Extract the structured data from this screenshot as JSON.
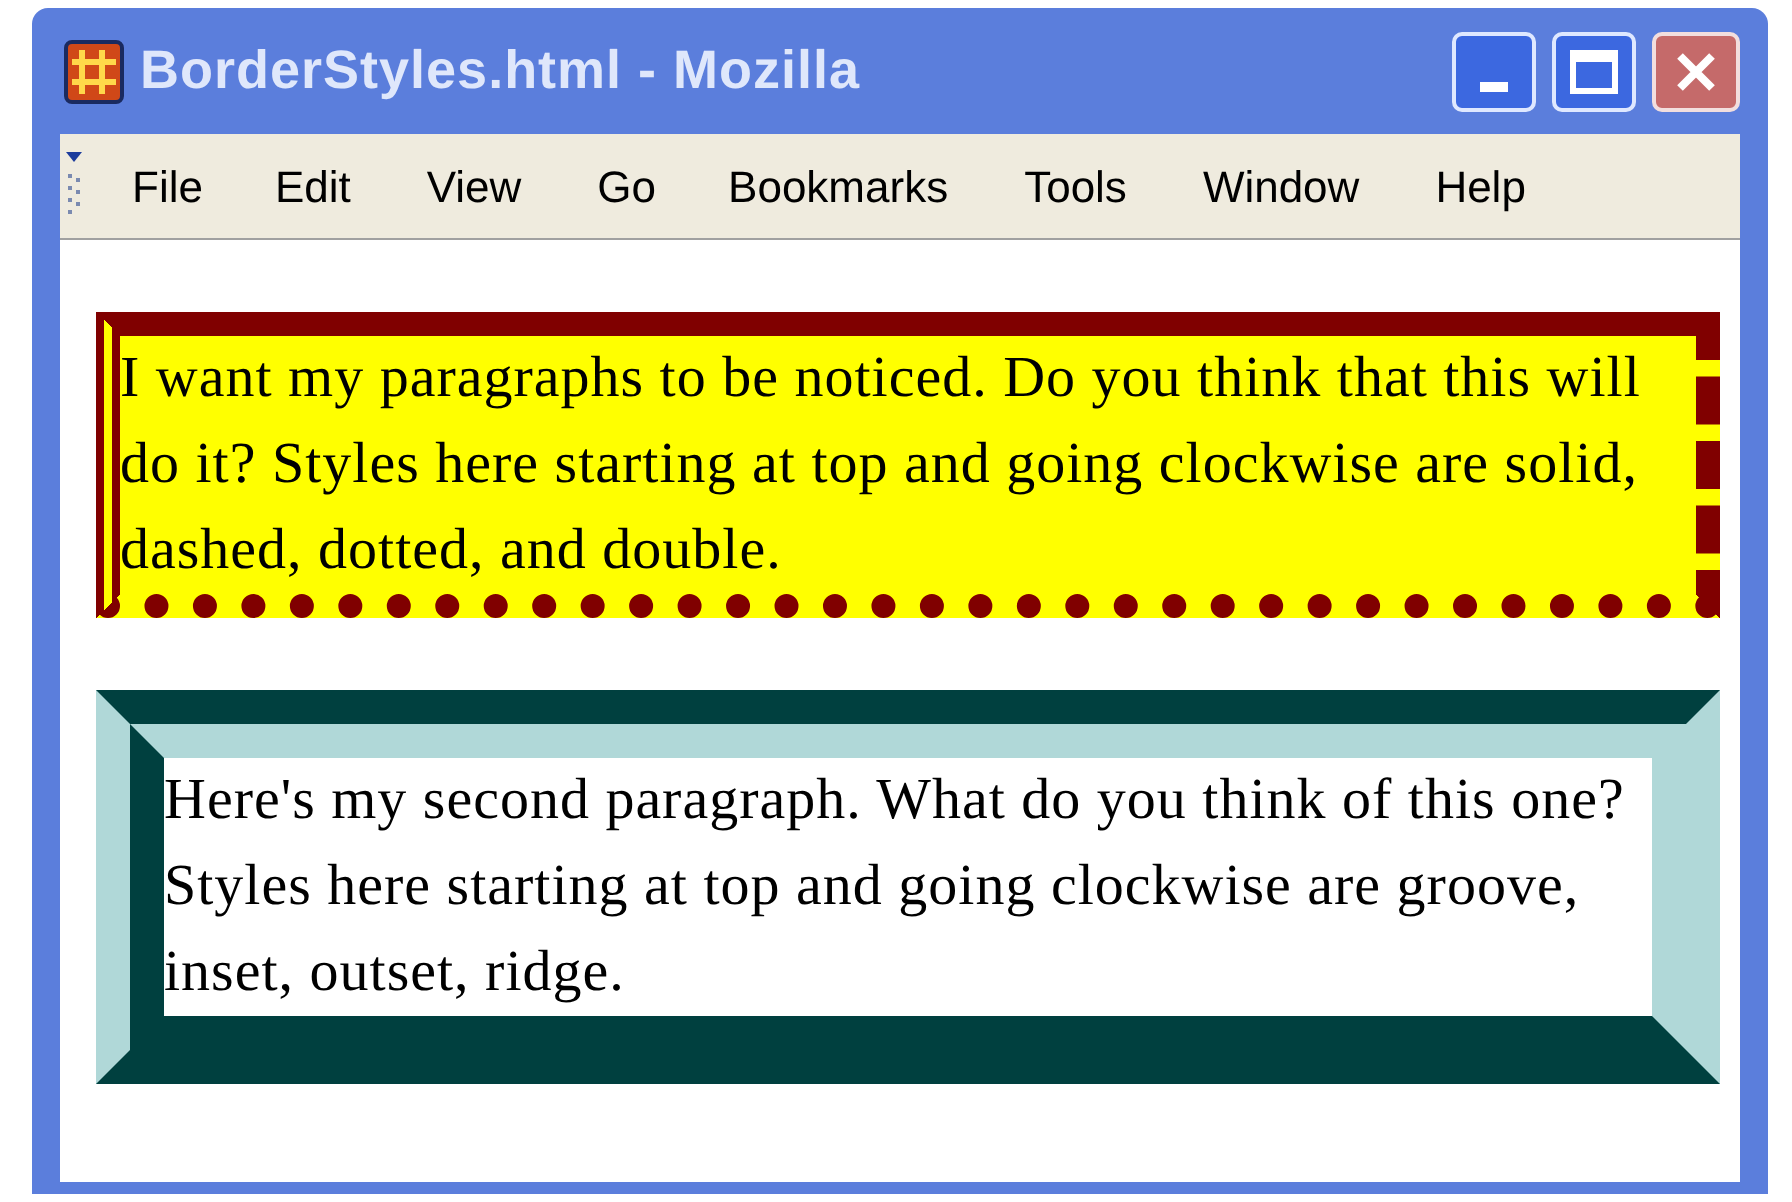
{
  "window": {
    "title": "BorderStyles.html - Mozilla"
  },
  "menu": [
    "File",
    "Edit",
    "View",
    "Go",
    "Bookmarks",
    "Tools",
    "Window",
    "Help"
  ],
  "paragraphs": [
    {
      "kind": "flat",
      "text": "I want my paragraphs to be noticed. Do you think that this will do it? Styles here starting at top and going clockwise are solid, dashed, dotted, and double."
    },
    {
      "kind": "sunken",
      "text": "Here's my second paragraph. What do you think of this one? Styles here starting at top and going clockwise are groove, inset, outset, ridge."
    }
  ]
}
